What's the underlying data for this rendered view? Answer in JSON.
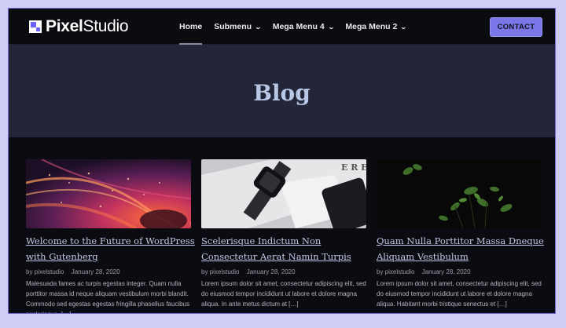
{
  "brand": {
    "name_bold": "Pixel",
    "name_light": "Studio"
  },
  "nav": {
    "items": [
      {
        "label": "Home",
        "has_dropdown": false,
        "active": true
      },
      {
        "label": "Submenu",
        "has_dropdown": true
      },
      {
        "label": "Mega Menu 4",
        "has_dropdown": true
      },
      {
        "label": "Mega Menu 2",
        "has_dropdown": true
      }
    ],
    "contact_label": "CONTACT"
  },
  "hero": {
    "title": "Blog"
  },
  "posts": [
    {
      "title": "Welcome to the Future of WordPress with Gutenberg",
      "author": "by pixelstudio",
      "date": "January 28, 2020",
      "excerpt": "Malesuada fames ac turpis egestas integer. Quam nulla porttitor massa id neque aliquam vestibulum morbi blandit. Commodo sed egestas egestas fringilla phasellus faucibus scelerisque. […]",
      "image": "abstract-orange-swirl"
    },
    {
      "title": "Scelerisque Indictum Non Consectetur Aerat Namin Turpis",
      "author": "by pixelstudio",
      "date": "January 28, 2020",
      "excerpt": "Lorem ipsum dolor sit amet, consectetur adipiscing elit, sed do eiusmod tempor incididunt ut labore et dolore magna aliqua. In ante metus dictum at […]",
      "image": "smartwatch-and-phone"
    },
    {
      "title": "Quam Nulla Porttitor Massa Dneque Aliquam Vestibulum",
      "author": "by pixelstudio",
      "date": "January 28, 2020",
      "excerpt": "Lorem ipsum dolor sit amet, consectetur adipiscing elit, sed do eiusmod tempor incididunt ut labore et dolore magna aliqua. Habitant morbi tristique senectus et […]",
      "image": "green-plant-leaves"
    }
  ],
  "colors": {
    "accent": "#7b77e8",
    "hero_bg": "#222638",
    "page_bg": "#0b0c11"
  }
}
